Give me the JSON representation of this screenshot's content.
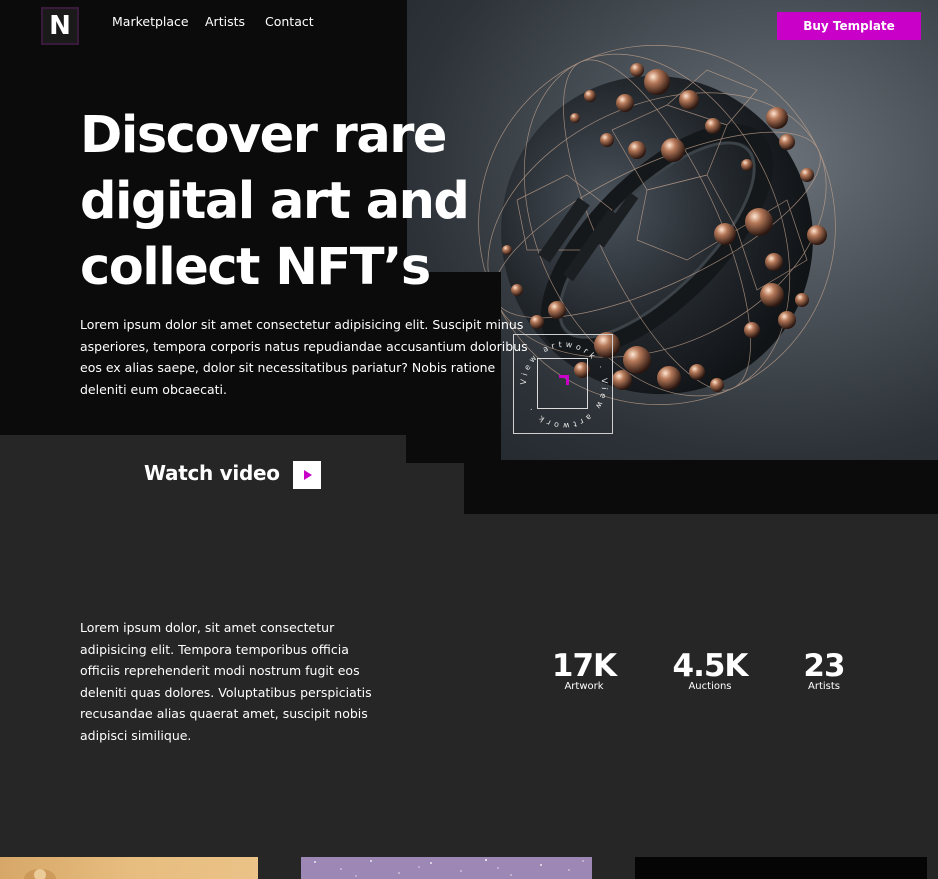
{
  "nav": {
    "logo": "N",
    "links": [
      "Marketplace",
      "Artists",
      "Contact"
    ],
    "cta": "Buy Template"
  },
  "hero": {
    "title_lines": [
      "Discover rare",
      "digital art and",
      "collect NFT’s"
    ],
    "description": "Lorem ipsum dolor sit amet consectetur adipisicing elit. Suscipit minus asperiores, tempora corporis natus repudiandae accusantium doloribus eos ex alias saepe, dolor sit necessitatibus pariatur? Nobis ratione deleniti eum obcaecati.",
    "badge_text": "View artwork · View artwork · ",
    "watch_label": "Watch video"
  },
  "about": {
    "description": "Lorem ipsum dolor, sit amet consectetur adipisicing elit. Tempora temporibus officia officiis reprehenderit modi nostrum fugit eos deleniti quas dolores. Voluptatibus perspiciatis recusandae alias quaerat amet, suscipit nobis adipisci similique."
  },
  "stats": [
    {
      "value": "17K",
      "label": "Artwork"
    },
    {
      "value": "4.5K",
      "label": "Auctions"
    },
    {
      "value": "23",
      "label": "Artists"
    }
  ],
  "theme": {
    "accent": "#c800c8",
    "background_dark": "#0b0b0b",
    "background": "#262626",
    "text": "#ffffff"
  },
  "icons": {
    "play": "play-icon",
    "arrow": "arrow-up-right-icon"
  }
}
